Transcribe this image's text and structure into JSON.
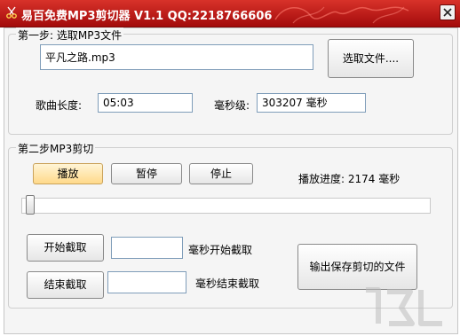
{
  "window": {
    "title": "易百免费MP3剪切器 V1.1  QQ:2218766606",
    "close_glyph": "×"
  },
  "step1": {
    "legend": "第一步: 选取MP3文件",
    "file_path": "平凡之路.mp3",
    "browse_label": "选取文件....",
    "song_length_label": "歌曲长度:",
    "song_length_value": "05:03",
    "ms_label": "毫秒级:",
    "ms_value": "303207  毫秒"
  },
  "step2": {
    "legend": "第二步MP3剪切",
    "play_label": "播放",
    "pause_label": "暂停",
    "stop_label": "停止",
    "progress_label": "播放进度: 2174  毫秒",
    "playback_fraction": 0.007,
    "start_cut_button": "开始截取",
    "start_cut_value": "",
    "start_cut_label": "毫秒开始截取",
    "end_cut_button": "结束截取",
    "end_cut_value": "",
    "end_cut_label": "毫秒结束截取",
    "save_label": "输出保存剪切的文件"
  },
  "colors": {
    "titlebar": "#c21a16",
    "selected_button": "#ffd98a"
  }
}
